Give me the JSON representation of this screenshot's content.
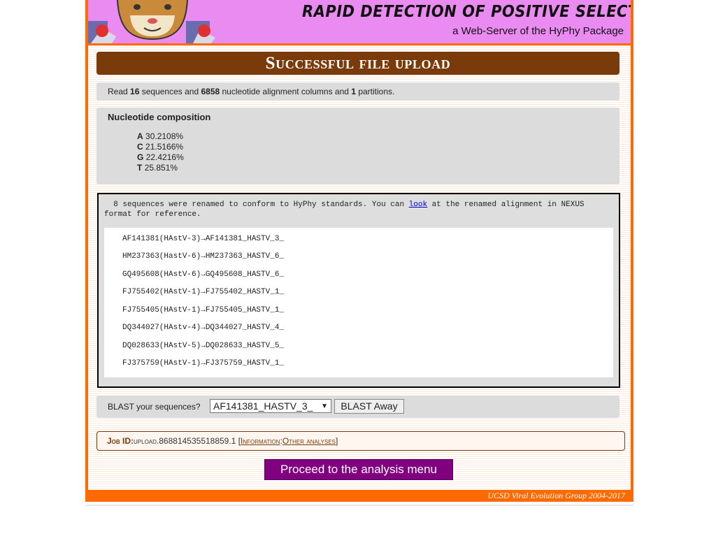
{
  "banner": {
    "title": "RAPID DETECTION OF POSITIVE SELECTION",
    "subtitle": "a Web-Server of the HyPhy Package"
  },
  "heading": "Successful file upload",
  "read": {
    "prefix": "Read ",
    "sequences": "16",
    "mid1": " sequences and ",
    "columns": "6858",
    "mid2": " nucleotide alignment columns and ",
    "partitions": "1",
    "suffix": " partitions."
  },
  "composition": {
    "title": "Nucleotide composition",
    "items": [
      {
        "base": "A",
        "value": "30.2108%"
      },
      {
        "base": "C",
        "value": "21.5166%"
      },
      {
        "base": "G",
        "value": "22.4216%"
      },
      {
        "base": "T",
        "value": "25.851%"
      }
    ]
  },
  "rename": {
    "msg_before": "  8 sequences were renamed to conform to HyPhy standards. You can ",
    "link": "look",
    "msg_after": " at the renamed alignment in NEXUS format for reference.",
    "rows": [
      "AF141381(HAstV-3)→AF141381_HASTV_3_",
      "HM237363(HastV-6)→HM237363_HASTV_6_",
      "GQ495608(HAstV-6)→GQ495608_HASTV_6_",
      "FJ755402(HAstV-1)→FJ755402_HASTV_1_",
      "FJ755405(HAstV-1)→FJ755405_HASTV_1_",
      "DQ344027(HAstv-4)→DQ344027_HASTV_4_",
      "DQ028633(HAstV-5)→DQ028633_HASTV_5_",
      "FJ375759(HAstV-1)→FJ375759_HASTV_1_"
    ]
  },
  "blast": {
    "label": "BLAST your sequences?",
    "selected": "AF141381_HASTV_3_",
    "button": "BLAST Away"
  },
  "job": {
    "label": "Job ID:",
    "id": "upload.868814535518859.1",
    "open": " [",
    "link1": "Information",
    "sep": ":",
    "link2": "Other analyses",
    "close": "]"
  },
  "proceed": "Proceed to the analysis menu",
  "footer": "UCSD Viral Evolution Group 2004-2017",
  "colors": {
    "accent": "#ff6a00",
    "heading": "#7a3a0a",
    "banner": "#e98bf0",
    "proceed": "#800080"
  }
}
